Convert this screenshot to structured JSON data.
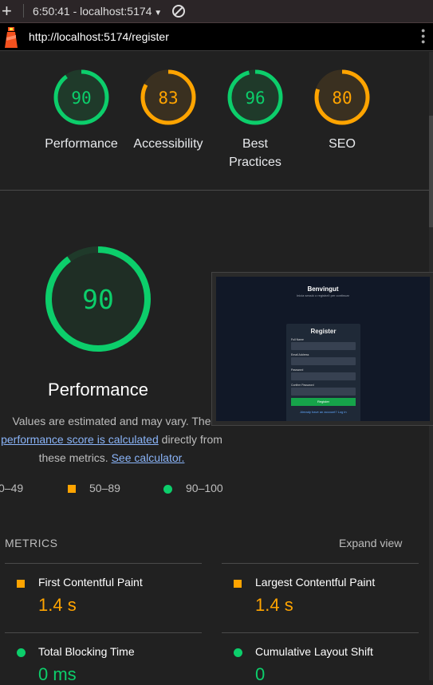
{
  "topbar": {
    "session": "6:50:41 - localhost:5174"
  },
  "urlbar": {
    "url": "http://localhost:5174/register"
  },
  "colors": {
    "pass": "#0cce6b",
    "average": "#ffa400",
    "fail": "#ff4e42"
  },
  "scores": [
    {
      "label": "Performance",
      "value": 90,
      "rating": "pass"
    },
    {
      "label": "Accessibility",
      "value": 83,
      "rating": "average"
    },
    {
      "label": "Best Practices",
      "value": 96,
      "rating": "pass"
    },
    {
      "label": "SEO",
      "value": 80,
      "rating": "average"
    }
  ],
  "perf": {
    "score": 90,
    "title": "Performance",
    "desc_1": "Values are estimated and may vary. The ",
    "desc_link1": "performance score is calculated",
    "desc_2": " directly from these metrics. ",
    "desc_link2": "See calculator.",
    "legend": [
      "0–49",
      "50–89",
      "90–100"
    ]
  },
  "thumbnail": {
    "heading": "Benvingut",
    "subheading": "Inicia sessió o registra't per continuar",
    "form_title": "Register",
    "fields": [
      "Full Name",
      "Email Address",
      "Password",
      "Confirm Password"
    ],
    "button": "Register",
    "login_link": "Already have an account? Log in"
  },
  "metrics": {
    "header": "METRICS",
    "expand": "Expand view",
    "items": [
      {
        "label": "First Contentful Paint",
        "value": "1.4 s",
        "rating": "average"
      },
      {
        "label": "Largest Contentful Paint",
        "value": "1.4 s",
        "rating": "average"
      },
      {
        "label": "Total Blocking Time",
        "value": "0 ms",
        "rating": "pass"
      },
      {
        "label": "Cumulative Layout Shift",
        "value": "0",
        "rating": "pass"
      }
    ]
  }
}
